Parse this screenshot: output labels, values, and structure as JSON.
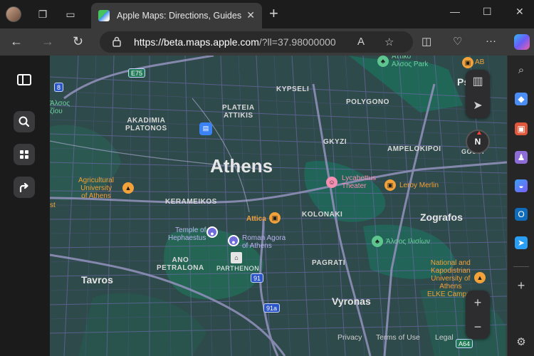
{
  "browser": {
    "tab": {
      "title": "Apple Maps: Directions, Guides & Traffic",
      "close": "✕"
    },
    "new_tab": "+",
    "window": {
      "minimize": "—",
      "maximize": "☐",
      "close": "✕"
    },
    "url": {
      "domain": "https://beta.maps.apple.com",
      "rest": "/?ll=37.98000000"
    },
    "omnibox_icons": {
      "read_aloud": "A",
      "favorite": "☆"
    },
    "toolbar_more": "···"
  },
  "maps_sidebar": {
    "icons": [
      "sidebar-toggle-icon",
      "search-icon",
      "guides-icon",
      "directions-icon"
    ]
  },
  "map": {
    "city": "Athens",
    "neighborhoods": {
      "kypseli": "KYPSELI",
      "plateia": "PLATEIA\nATTIKIS",
      "polygono": "POLYGONO",
      "akadimia": "AKADIMIA\nPLATONOS",
      "gkyzi": "GKYZI",
      "ampelokipoi": "AMPELOKIPOI",
      "kerameikos": "KERAMEIKOS",
      "kolonaki": "KOLONAKI",
      "ano_petralona": "ANO\nPETRALONA",
      "pagrati": "PAGRATI",
      "parthenon": "PARTHENON"
    },
    "places": {
      "zografos": "Zografos",
      "tavros": "Tavros",
      "vyronas": "Vyronas",
      "psychiko": "Ps"
    },
    "pois": {
      "attiko_park": "Αττικό\nΑλσος Park",
      "ab": "AB",
      "agricultural": "Agricultural\nUniversity\nof Athens",
      "lycabettus": "Lycabettus\nTheater",
      "leroy": "Leroy Merlin",
      "attica": "Attica",
      "temple": "Temple of\nHephaestus",
      "agora": "Roman Agora\nof Athens",
      "alsos": "Άλσος Ιλισίων",
      "kapodistrian": "National and\nKapodistrian\nUniversity of\nAthens\nELKE Campus",
      "west_green": "Άλσος\nζίου",
      "gouri": "GOUDI",
      "east_edge": "st"
    },
    "shields": {
      "e75": "E75",
      "r8": "8",
      "r91": "91",
      "r91a": "91a",
      "a64": "A64"
    },
    "controls": {
      "compass": "N",
      "zoom_in": "+",
      "zoom_out": "−"
    },
    "footer": {
      "privacy": "Privacy",
      "terms": "Terms of Use",
      "legal": "Legal"
    }
  },
  "colors": {
    "map_bg": "#2f4a4a",
    "street": "#6b6aa8",
    "park": "#1f6a5a",
    "highway": "#8f8fb8",
    "accent_blue": "#3b82f6"
  }
}
